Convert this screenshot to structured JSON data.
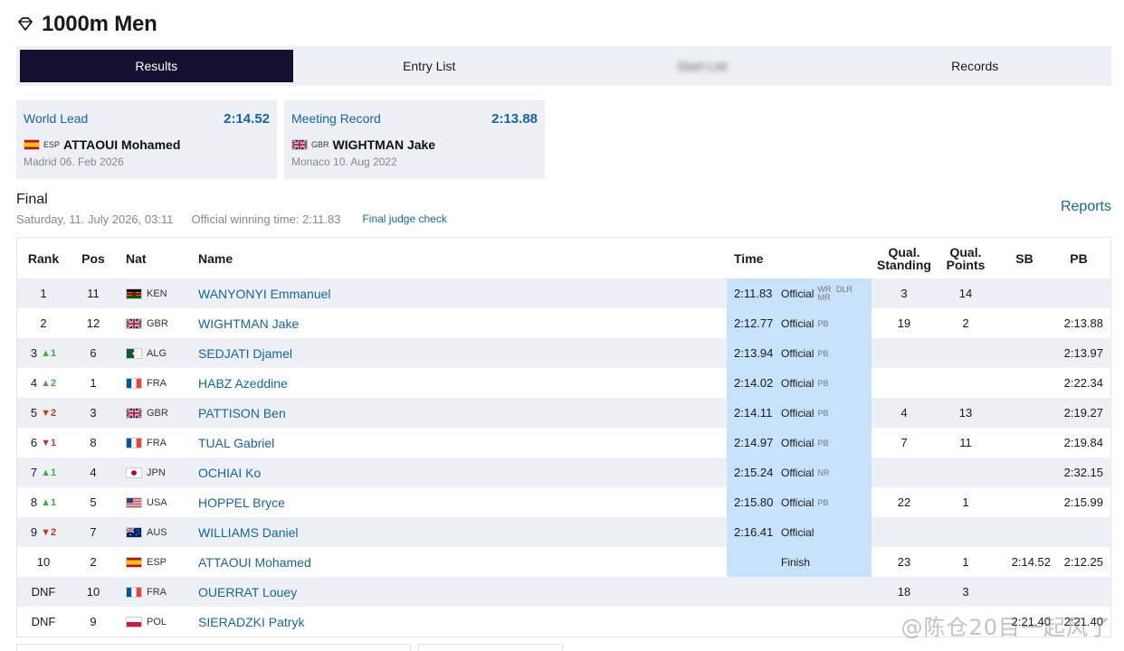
{
  "page": {
    "title": "1000m Men"
  },
  "tabs": [
    {
      "label": "Results",
      "active": true
    },
    {
      "label": "Entry List",
      "active": false
    },
    {
      "label": "Start List",
      "active": false,
      "blurred": true
    },
    {
      "label": "Records",
      "active": false
    }
  ],
  "records": [
    {
      "label": "World Lead",
      "time": "2:14.52",
      "country": "ESP",
      "athlete": "ATTAOUI Mohamed",
      "venue": "Madrid 06. Feb 2026"
    },
    {
      "label": "Meeting Record",
      "time": "2:13.88",
      "country": "GBR",
      "athlete": "WIGHTMAN Jake",
      "venue": "Monaco 10. Aug 2022"
    }
  ],
  "final": {
    "title": "Final",
    "date": "Saturday, 11. July 2026, 03:11",
    "winning_time": "Official winning time: 2:11.83",
    "judge_link": "Final judge check",
    "reports_link": "Reports"
  },
  "table": {
    "headers": {
      "rank": "Rank",
      "pos": "Pos",
      "nat": "Nat",
      "name": "Name",
      "time": "Time",
      "qual_standing_1": "Qual.",
      "qual_standing_2": "Standing",
      "qual_points_1": "Qual.",
      "qual_points_2": "Points",
      "sb": "SB",
      "pb": "PB"
    },
    "rows": [
      {
        "rank": "1",
        "change": "",
        "dir": "",
        "pos": "11",
        "nat": "KEN",
        "name": "WANYONYI Emmanuel",
        "time": "2:11.83",
        "status": "Official",
        "rec": "WR DLR MR",
        "qs": "3",
        "qp": "14",
        "sb": "",
        "pb": ""
      },
      {
        "rank": "2",
        "change": "",
        "dir": "",
        "pos": "12",
        "nat": "GBR",
        "name": "WIGHTMAN Jake",
        "time": "2:12.77",
        "status": "Official",
        "rec": "PB",
        "qs": "19",
        "qp": "2",
        "sb": "",
        "pb": "2:13.88"
      },
      {
        "rank": "3",
        "change": "1",
        "dir": "up",
        "pos": "6",
        "nat": "ALG",
        "name": "SEDJATI Djamel",
        "time": "2:13.94",
        "status": "Official",
        "rec": "PB",
        "qs": "",
        "qp": "",
        "sb": "",
        "pb": "2:13.97"
      },
      {
        "rank": "4",
        "change": "2",
        "dir": "up",
        "pos": "1",
        "nat": "FRA",
        "name": "HABZ Azeddine",
        "time": "2:14.02",
        "status": "Official",
        "rec": "PB",
        "qs": "",
        "qp": "",
        "sb": "",
        "pb": "2:22.34"
      },
      {
        "rank": "5",
        "change": "2",
        "dir": "down",
        "pos": "3",
        "nat": "GBR",
        "name": "PATTISON Ben",
        "time": "2:14.11",
        "status": "Official",
        "rec": "PB",
        "qs": "4",
        "qp": "13",
        "sb": "",
        "pb": "2:19.27"
      },
      {
        "rank": "6",
        "change": "1",
        "dir": "down",
        "pos": "8",
        "nat": "FRA",
        "name": "TUAL Gabriel",
        "time": "2:14.97",
        "status": "Official",
        "rec": "PB",
        "qs": "7",
        "qp": "11",
        "sb": "",
        "pb": "2:19.84"
      },
      {
        "rank": "7",
        "change": "1",
        "dir": "up",
        "pos": "4",
        "nat": "JPN",
        "name": "OCHIAI Ko",
        "time": "2:15.24",
        "status": "Official",
        "rec": "NR",
        "qs": "",
        "qp": "",
        "sb": "",
        "pb": "2:32.15"
      },
      {
        "rank": "8",
        "change": "1",
        "dir": "up",
        "pos": "5",
        "nat": "USA",
        "name": "HOPPEL Bryce",
        "time": "2:15.80",
        "status": "Official",
        "rec": "PB",
        "qs": "22",
        "qp": "1",
        "sb": "",
        "pb": "2:15.99"
      },
      {
        "rank": "9",
        "change": "2",
        "dir": "down",
        "pos": "7",
        "nat": "AUS",
        "name": "WILLIAMS Daniel",
        "time": "2:16.41",
        "status": "Official",
        "rec": "",
        "qs": "",
        "qp": "",
        "sb": "",
        "pb": ""
      },
      {
        "rank": "10",
        "change": "",
        "dir": "",
        "pos": "2",
        "nat": "ESP",
        "name": "ATTAOUI Mohamed",
        "time": "",
        "status": "Finish",
        "rec": "",
        "qs": "23",
        "qp": "1",
        "sb": "2:14.52",
        "pb": "2:12.25"
      },
      {
        "rank": "DNF",
        "change": "",
        "dir": "",
        "pos": "10",
        "nat": "FRA",
        "name": "OUERRAT Louey",
        "time": "",
        "status": "",
        "rec": "",
        "qs": "18",
        "qp": "3",
        "sb": "",
        "pb": "",
        "plain": true
      },
      {
        "rank": "DNF",
        "change": "",
        "dir": "",
        "pos": "9",
        "nat": "POL",
        "name": "SIERADZKI Patryk",
        "time": "",
        "status": "",
        "rec": "",
        "qs": "",
        "qp": "",
        "sb": "2:21.40",
        "pb": "2:21.40",
        "plain": true
      }
    ]
  },
  "watermark": "@陈仓20目一起风了",
  "colors": {
    "accent": "#1565a8",
    "active_tab": "#15102f",
    "panel": "#edf0f4",
    "time_highlight": "#c7e2fb",
    "up": "#3cb043",
    "down": "#c0392b"
  }
}
